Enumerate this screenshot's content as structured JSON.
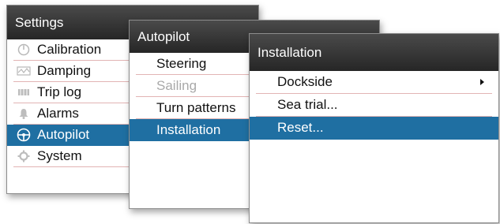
{
  "settings": {
    "title": "Settings",
    "items": [
      {
        "label": "Calibration",
        "icon": "calibration-icon"
      },
      {
        "label": "Damping",
        "icon": "damping-icon"
      },
      {
        "label": "Trip log",
        "icon": "trip-log-icon"
      },
      {
        "label": "Alarms",
        "icon": "alarm-bell-icon"
      },
      {
        "label": "Autopilot",
        "icon": "steering-wheel-icon",
        "selected": true
      },
      {
        "label": "System",
        "icon": "gear-icon"
      }
    ]
  },
  "autopilot": {
    "title": "Autopilot",
    "items": [
      {
        "label": "Steering"
      },
      {
        "label": "Sailing",
        "disabled": true
      },
      {
        "label": "Turn patterns"
      },
      {
        "label": "Installation",
        "selected": true
      }
    ]
  },
  "installation": {
    "title": "Installation",
    "items": [
      {
        "label": "Dockside",
        "has_submenu": true
      },
      {
        "label": "Sea trial..."
      },
      {
        "label": "Reset...",
        "selected": true
      }
    ]
  },
  "colors": {
    "title_bar": "#333333",
    "selection": "#1f6fa2",
    "disabled_text": "#a9a9a9",
    "divider": "#e2b4b4"
  }
}
